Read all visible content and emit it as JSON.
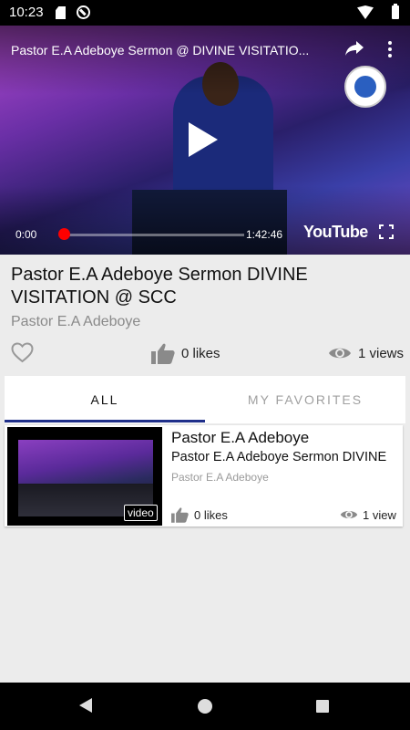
{
  "status_bar": {
    "time": "10:23",
    "icons": [
      "sd-card-icon",
      "do-not-disturb-icon",
      "wifi-icon",
      "battery-icon"
    ]
  },
  "player": {
    "title": "Pastor E.A Adeboye Sermon @ DIVINE VISITATIO...",
    "current_time": "0:00",
    "total_time": "1:42:46",
    "progress": 0.0,
    "brand": "YouTube"
  },
  "video": {
    "title": "Pastor E.A Adeboye Sermon DIVINE VISITATION @ SCC",
    "author": "Pastor E.A Adeboye",
    "likes": "0 likes",
    "views": "1 views"
  },
  "tabs": {
    "all": "ALL",
    "favorites": "MY FAVORITES",
    "active": "all"
  },
  "list": {
    "items": [
      {
        "heading": "Pastor E.A Adeboye",
        "title": "Pastor E.A Adeboye Sermon DIVINE",
        "author": "Pastor E.A Adeboye",
        "badge": "video",
        "likes": "0 likes",
        "views": "1 view"
      }
    ]
  },
  "colors": {
    "accent": "#1f2f8a",
    "progress": "#ff0000",
    "background": "#ececec"
  }
}
